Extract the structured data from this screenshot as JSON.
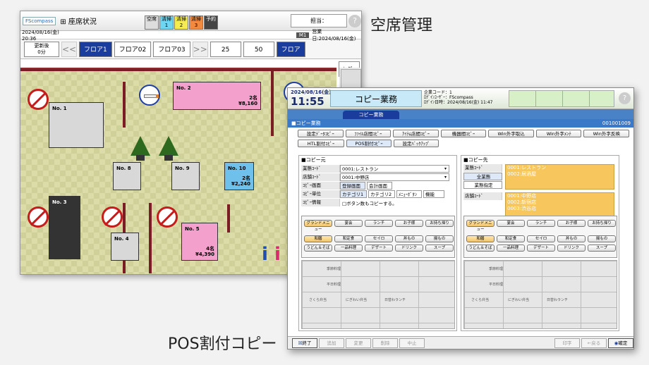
{
  "captions": {
    "top": "空席管理",
    "bottom": "POS割付コピー"
  },
  "seat": {
    "logo": "FScompass",
    "title": "座席状況",
    "chips": [
      {
        "label": "空席",
        "color": "#dddddd"
      },
      {
        "label": "清掃 1",
        "color": "#6ed6f0"
      },
      {
        "label": "清掃 2",
        "color": "#f4ec50"
      },
      {
        "label": "清掃 3",
        "color": "#f08a40"
      },
      {
        "label": "予約",
        "color": "#444444"
      }
    ],
    "tanto": "担当：",
    "help": "?",
    "datetime": "2024/08/16(金) 20:36",
    "mode": "M1",
    "biz_date": "営業日:2024/08/16(金)",
    "update": {
      "l1": "更新後",
      "l2": "0分"
    },
    "prev": "<<",
    "next": ">>",
    "floors": [
      "フロア1",
      "フロア02",
      "フロア03"
    ],
    "nums": [
      "25",
      "50"
    ],
    "floor_btn": "フロア",
    "order_btn": "ｵｰﾀﾞｰ",
    "tables": [
      {
        "no": "No.  1",
        "ppl": "",
        "amt": ""
      },
      {
        "no": "No.  2",
        "ppl": "2名",
        "amt": "¥8,160"
      },
      {
        "no": "No.  3",
        "ppl": "",
        "amt": ""
      },
      {
        "no": "No.  4",
        "ppl": "",
        "amt": ""
      },
      {
        "no": "No.  5",
        "ppl": "4名",
        "amt": "¥4,390"
      },
      {
        "no": "No.  8",
        "ppl": "",
        "amt": ""
      },
      {
        "no": "No.  9",
        "ppl": "",
        "amt": ""
      },
      {
        "no": "No.  10",
        "ppl": "2名",
        "amt": "¥2,240"
      }
    ],
    "colors": {
      "pink": "#f4a0cc",
      "gray": "#d8d8d8",
      "blue": "#70c0ec",
      "dark": "#333333"
    }
  },
  "copy": {
    "date": "2024/08/16(金)",
    "time": "11:55",
    "title": "コピー業務",
    "corp": [
      "企業コード：1",
      "ﾛｸﾞｲﾝﾕｰｻﾞｰ：FScompass",
      "ﾛｸﾞｲﾝ日時：2024/08/16(金) 11:47"
    ],
    "tab": "コピー業務",
    "section": "■コピー業務",
    "section_code": "001001009",
    "help": "?",
    "row1": [
      "設定ﾃﾞｰﾀｺﾋﾟｰ",
      "ﾌｧｲﾙ店間ｺﾋﾟｰ",
      "ｱｲﾃﾑ店間ｺﾋﾟｰ",
      "機器間ｺﾋﾟｰ",
      "Win外字取込",
      "Win外字ﾒﾝﾃ",
      "Win外字反映"
    ],
    "row2": [
      "HTL割付ｺﾋﾟｰ",
      "POS割付ｺﾋﾟｰ",
      "設定ﾊﾞｯｸｱｯﾌﾟ"
    ],
    "src": {
      "header": "■コピー元",
      "f_gyotai": "業態ｺｰﾄﾞ",
      "v_gyotai": "0001:レストラン",
      "f_tenpo": "店舗ｺｰﾄﾞ",
      "v_tenpo": "0001:中野店",
      "f_gamen": "ｺﾋﾟｰ画面",
      "gamen": [
        "登録画面",
        "会計画面"
      ],
      "f_tani": "ｺﾋﾟｰ単位",
      "tani": [
        "カテゴリ1",
        "カテゴリ2",
        "ﾒﾆｭｰﾎﾞﾀﾝ",
        "機能"
      ],
      "f_info": "ｺﾋﾟｰ情報",
      "info": "□ボタン数もコピーする。",
      "cats1": [
        "グランドメニュー",
        "宴会",
        "ランチ",
        "お子様",
        "お持ち帰り"
      ],
      "cats2": [
        "和膳",
        "和定食",
        "セイロ",
        "丼もの",
        "揚もの"
      ],
      "cats3": [
        "うどん＆そば",
        "一品料理",
        "デザート",
        "ドリンク",
        "スープ"
      ],
      "grid": [
        "季節料理",
        "平日料理",
        "さくら弁当",
        "にぎわい弁当",
        "日替わランチ"
      ]
    },
    "dst": {
      "header": "■コピー先",
      "f_gyotai": "業態ｺｰﾄﾞ",
      "all": "全業態",
      "pick": "業態指定",
      "gyotai": [
        "0001:レストラン",
        "0002:居酒屋"
      ],
      "f_tenpo": "店舗ｺｰﾄﾞ",
      "tenpo": [
        "0001:中野店",
        "0002:新宿店",
        "0003:渋谷店"
      ],
      "cats1": [
        "グランドメニュー",
        "宴会",
        "ランチ",
        "お子様",
        "お持ち帰り"
      ],
      "cats2": [
        "和膳",
        "和定食",
        "セイロ",
        "丼もの",
        "揚もの"
      ],
      "cats3": [
        "うどん＆そば",
        "一品料理",
        "デザート",
        "ドリンク",
        "スープ"
      ],
      "grid": [
        "季節料理",
        "平日料理",
        "さくら弁当",
        "にぎわい弁当",
        "日替わランチ"
      ]
    },
    "footer": [
      "終了",
      "追加",
      "変更",
      "削除",
      "中止",
      "印字",
      "戻る",
      "確定"
    ]
  }
}
